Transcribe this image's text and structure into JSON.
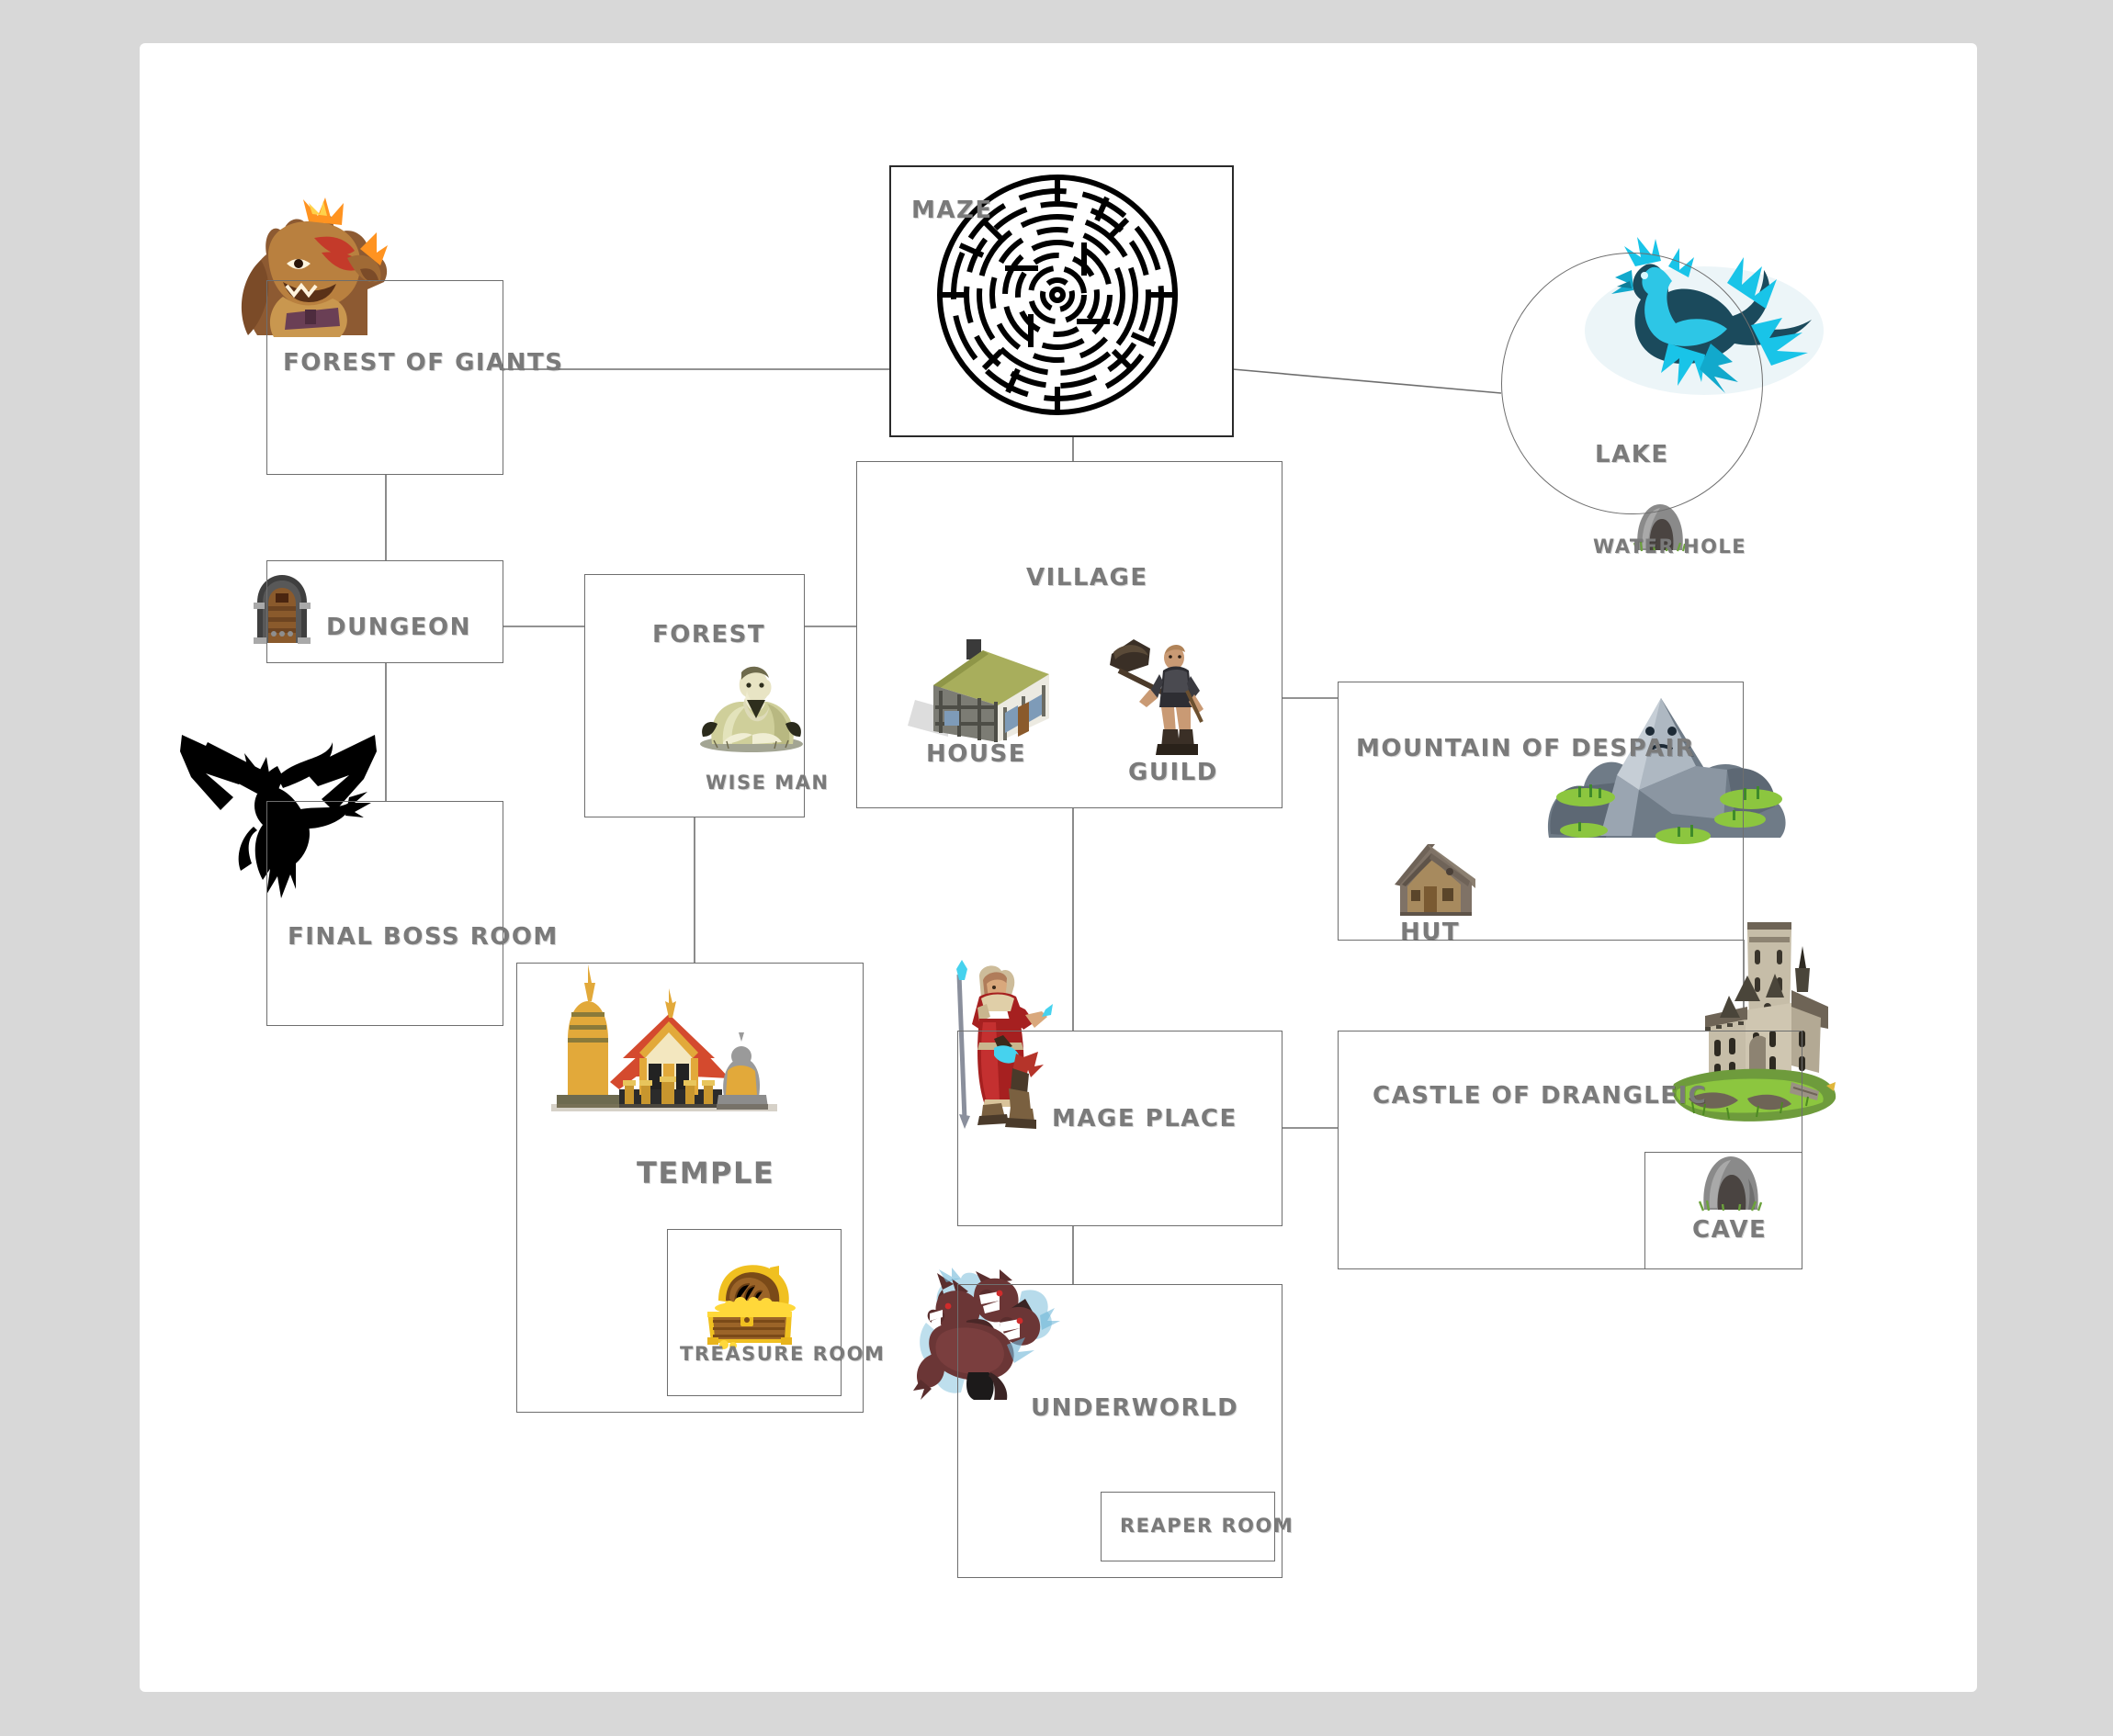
{
  "page": {
    "background_color": "#d8d8d8",
    "canvas_color": "#ffffff",
    "label_color": "#7a7a7a",
    "edge_color": "#6e6e6e"
  },
  "nodes": {
    "forest_of_giants": {
      "label": "FOREST OF GIANTS",
      "icon": "giant-ogre-icon"
    },
    "maze": {
      "label": "MAZE",
      "icon": "circular-maze-icon"
    },
    "lake": {
      "label": "LAKE",
      "icon": "water-dragon-icon"
    },
    "water_hole": {
      "label": "WATER HOLE",
      "icon": "cave-entrance-icon"
    },
    "dungeon": {
      "label": "DUNGEON",
      "icon": "stone-door-icon"
    },
    "forest": {
      "label": "FOREST",
      "icon": ""
    },
    "wise_man": {
      "label": "WISE MAN",
      "icon": "seated-sage-icon"
    },
    "village": {
      "label": "VILLAGE",
      "icon": ""
    },
    "house": {
      "label": "HOUSE",
      "icon": "cottage-icon"
    },
    "guild": {
      "label": "GUILD",
      "icon": "axe-warrior-icon"
    },
    "mountain_of_despair": {
      "label": "MOUNTAIN OF DESPAIR",
      "icon": "sad-mountain-icon"
    },
    "hut": {
      "label": "HUT",
      "icon": "wooden-hut-icon"
    },
    "final_boss_room": {
      "label": "FINAL BOSS ROOM",
      "icon": "winged-reaper-demon-icon"
    },
    "temple": {
      "label": "TEMPLE",
      "icon": "thai-temple-icon"
    },
    "treasure_room": {
      "label": "TREASURE ROOM",
      "icon": "treasure-chest-icon"
    },
    "mage_place": {
      "label": "MAGE PLACE",
      "icon": "red-robed-mage-icon"
    },
    "castle_of_drangleic": {
      "label": "CASTLE OF DRANGLEIC",
      "icon": "stone-castle-icon"
    },
    "cave": {
      "label": "CAVE",
      "icon": "cave-entrance-icon"
    },
    "underworld": {
      "label": "UNDERWORLD",
      "icon": "cerberus-icon"
    },
    "reaper_room": {
      "label": "REAPER ROOM",
      "icon": ""
    }
  },
  "edges": [
    {
      "from": "forest_of_giants",
      "to": "maze"
    },
    {
      "from": "forest_of_giants",
      "to": "dungeon"
    },
    {
      "from": "maze",
      "to": "lake"
    },
    {
      "from": "maze",
      "to": "village"
    },
    {
      "from": "dungeon",
      "to": "final_boss_room"
    },
    {
      "from": "dungeon",
      "to": "forest"
    },
    {
      "from": "forest",
      "to": "village"
    },
    {
      "from": "forest",
      "to": "temple"
    },
    {
      "from": "village",
      "to": "mountain_of_despair"
    },
    {
      "from": "village",
      "to": "mage_place"
    },
    {
      "from": "mountain_of_despair",
      "to": "castle_of_drangleic"
    },
    {
      "from": "mage_place",
      "to": "castle_of_drangleic"
    },
    {
      "from": "mage_place",
      "to": "underworld"
    }
  ]
}
